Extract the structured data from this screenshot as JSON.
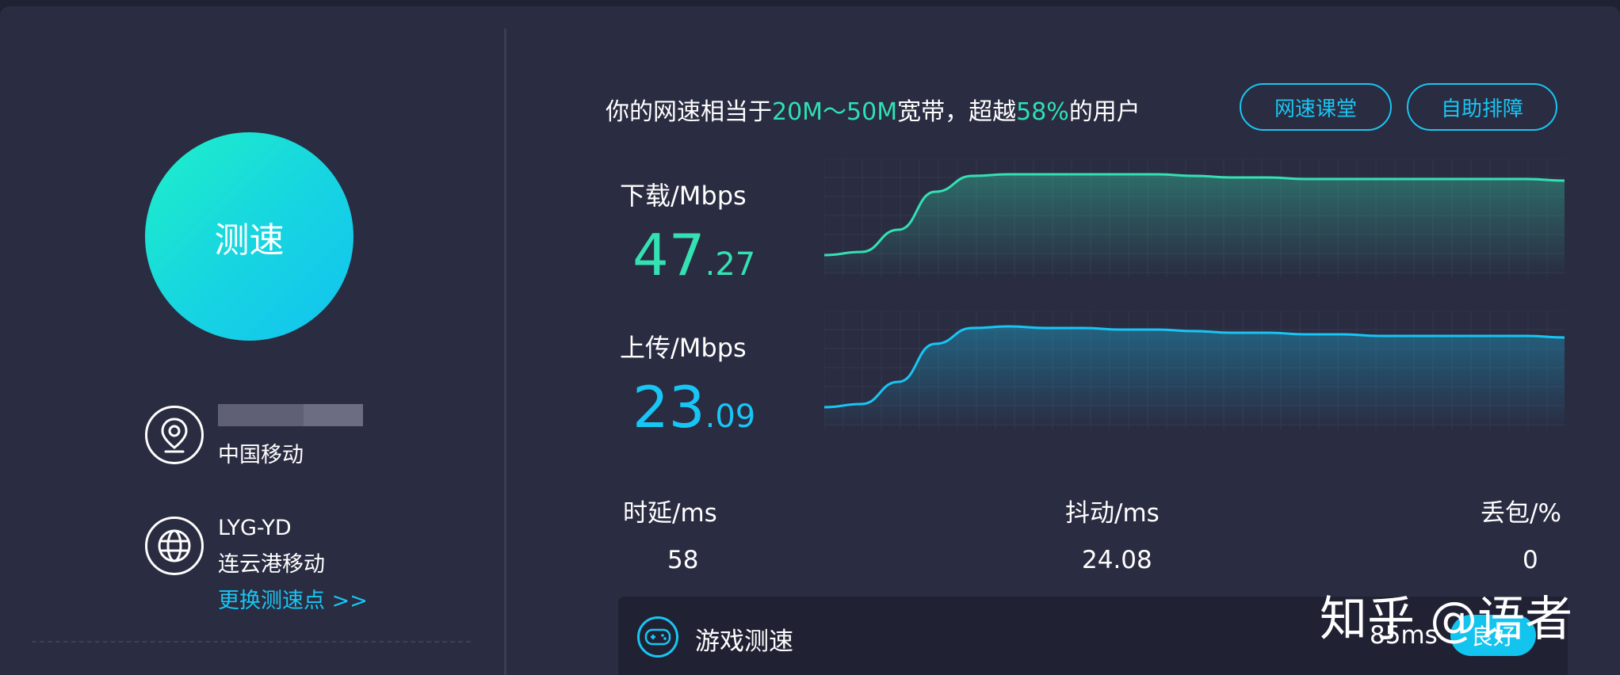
{
  "left": {
    "speed_button": "测速",
    "isp": "中国移动",
    "node": {
      "name": "LYG-YD",
      "location": "连云港移动",
      "change_link": "更换测速点 >>"
    }
  },
  "summary": {
    "prefix": "你的网速相当于",
    "bandwidth": "20M～50M",
    "middle": "宽带，超越",
    "percent": "58%",
    "suffix": "的用户"
  },
  "buttons": {
    "course": "网速课堂",
    "self_help": "自助排障"
  },
  "download": {
    "label": "下载/Mbps",
    "int": "47",
    "dec": ".27"
  },
  "upload": {
    "label": "上传/Mbps",
    "int": "23",
    "dec": ".09"
  },
  "stats": {
    "latency": {
      "label": "时延/ms",
      "value": "58"
    },
    "jitter": {
      "label": "抖动/ms",
      "value": "24.08"
    },
    "loss": {
      "label": "丢包/%",
      "value": "0"
    }
  },
  "game": {
    "label": "游戏测速",
    "ping": "85ms",
    "status": "良好"
  },
  "watermark": "知乎 @语者",
  "colors": {
    "accent": "#18c6f3",
    "download": "#33e1b2",
    "upload": "#17c6f5",
    "background": "#2a2c41"
  },
  "chart_data": [
    {
      "type": "area",
      "name": "download",
      "x": [
        0,
        5,
        10,
        15,
        20,
        25,
        30,
        35,
        40,
        45,
        50,
        55,
        60,
        65,
        70,
        75,
        80,
        85,
        90,
        95,
        100
      ],
      "values": [
        4,
        6,
        20,
        44,
        54,
        55,
        55,
        55,
        55,
        55,
        54,
        53,
        53,
        52,
        52,
        52,
        52,
        52,
        52,
        52,
        51
      ],
      "ylim": [
        0,
        60
      ]
    },
    {
      "type": "area",
      "name": "upload",
      "x": [
        0,
        5,
        10,
        15,
        20,
        25,
        30,
        35,
        40,
        45,
        50,
        55,
        60,
        65,
        70,
        75,
        80,
        85,
        90,
        95,
        100
      ],
      "values": [
        4,
        6,
        20,
        44,
        54,
        55,
        54,
        54,
        53,
        53,
        52,
        51,
        51,
        50,
        50,
        49,
        49,
        49,
        49,
        49,
        48
      ],
      "ylim": [
        0,
        60
      ]
    }
  ]
}
